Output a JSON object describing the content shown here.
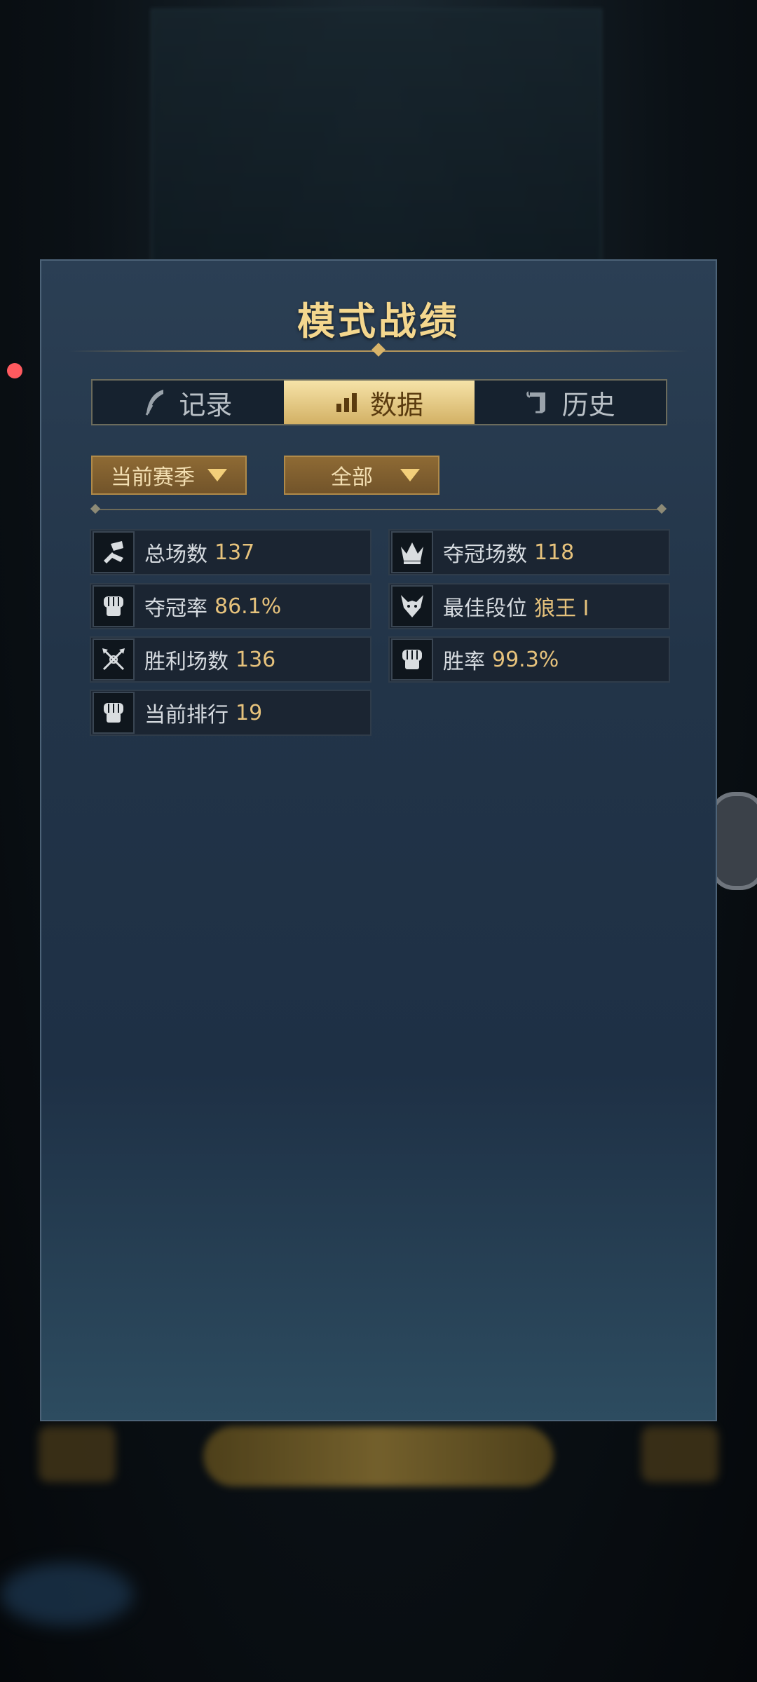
{
  "panel": {
    "title": "模式战绩"
  },
  "tabs": [
    {
      "label": "记录",
      "icon": "quill-icon",
      "active": false
    },
    {
      "label": "数据",
      "icon": "bar-chart-icon",
      "active": true
    },
    {
      "label": "历史",
      "icon": "scroll-icon",
      "active": false
    }
  ],
  "filters": {
    "season": "当前赛季",
    "scope": "全部"
  },
  "stats": [
    {
      "label": "总场数",
      "value": "137",
      "icon": "hand-card-icon"
    },
    {
      "label": "夺冠场数",
      "value": "118",
      "icon": "crown-icon"
    },
    {
      "label": "夺冠率",
      "value": "86.1%",
      "icon": "fist-icon"
    },
    {
      "label": "最佳段位",
      "value": "狼王 I",
      "icon": "wolf-icon"
    },
    {
      "label": "胜利场数",
      "value": "136",
      "icon": "crossed-weapons-icon"
    },
    {
      "label": "胜率",
      "value": "99.3%",
      "icon": "fist-icon"
    },
    {
      "label": "当前排行",
      "value": "19",
      "icon": "fist-icon"
    }
  ],
  "colors": {
    "accent_gold": "#f4d78e",
    "value_gold": "#e6c27c",
    "notification": "#ff5a5f"
  }
}
